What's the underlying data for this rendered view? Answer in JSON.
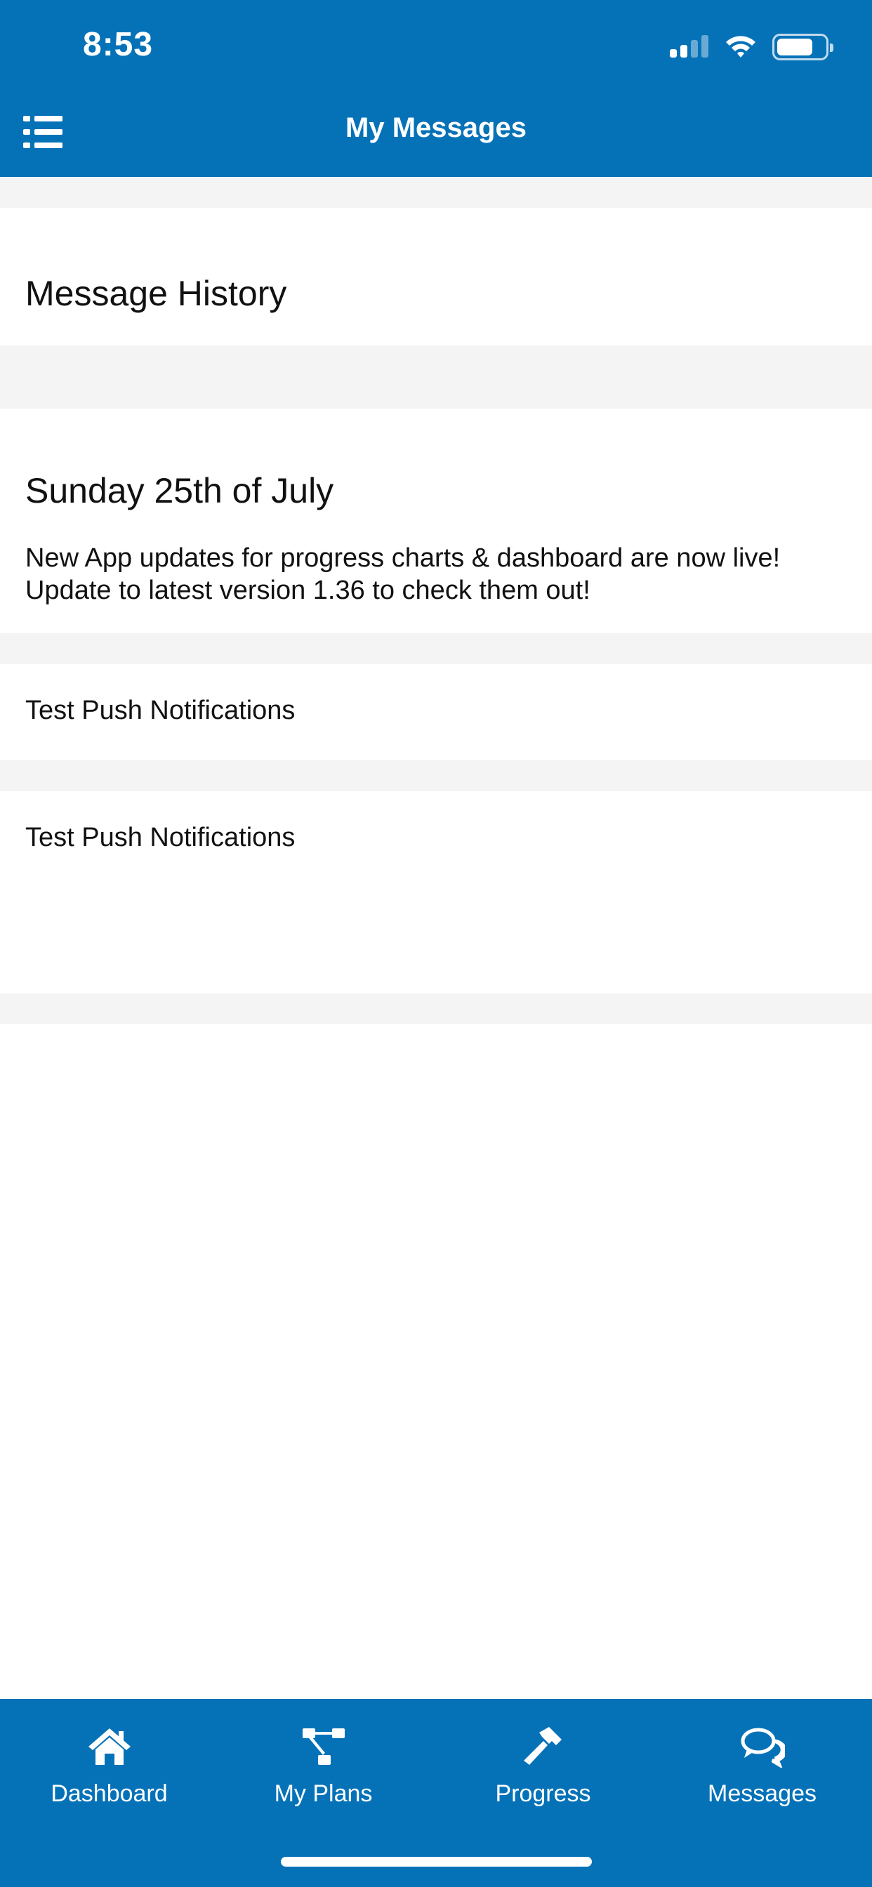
{
  "status_bar": {
    "time": "8:53",
    "battery_level": 0.75,
    "signal_bars_active": 2,
    "signal_bars_total": 4
  },
  "nav": {
    "title": "My Messages",
    "menu_icon": "list-icon"
  },
  "section": {
    "title": "Message History"
  },
  "messages": [
    {
      "date": "Sunday 25th of July",
      "body": "New App updates for progress charts & dashboard are now live!\nUpdate to latest version 1.36 to check them out!"
    },
    {
      "body": "Test Push Notifications"
    },
    {
      "body": "Test Push Notifications"
    }
  ],
  "tabs": [
    {
      "label": "Dashboard",
      "icon": "home-icon"
    },
    {
      "label": "My Plans",
      "icon": "flowchart-icon"
    },
    {
      "label": "Progress",
      "icon": "hammer-icon"
    },
    {
      "label": "Messages",
      "icon": "chat-bubbles-icon"
    }
  ],
  "colors": {
    "brand_blue": "#0572b8",
    "background_gray": "#f4f4f4",
    "text": "#111111"
  }
}
